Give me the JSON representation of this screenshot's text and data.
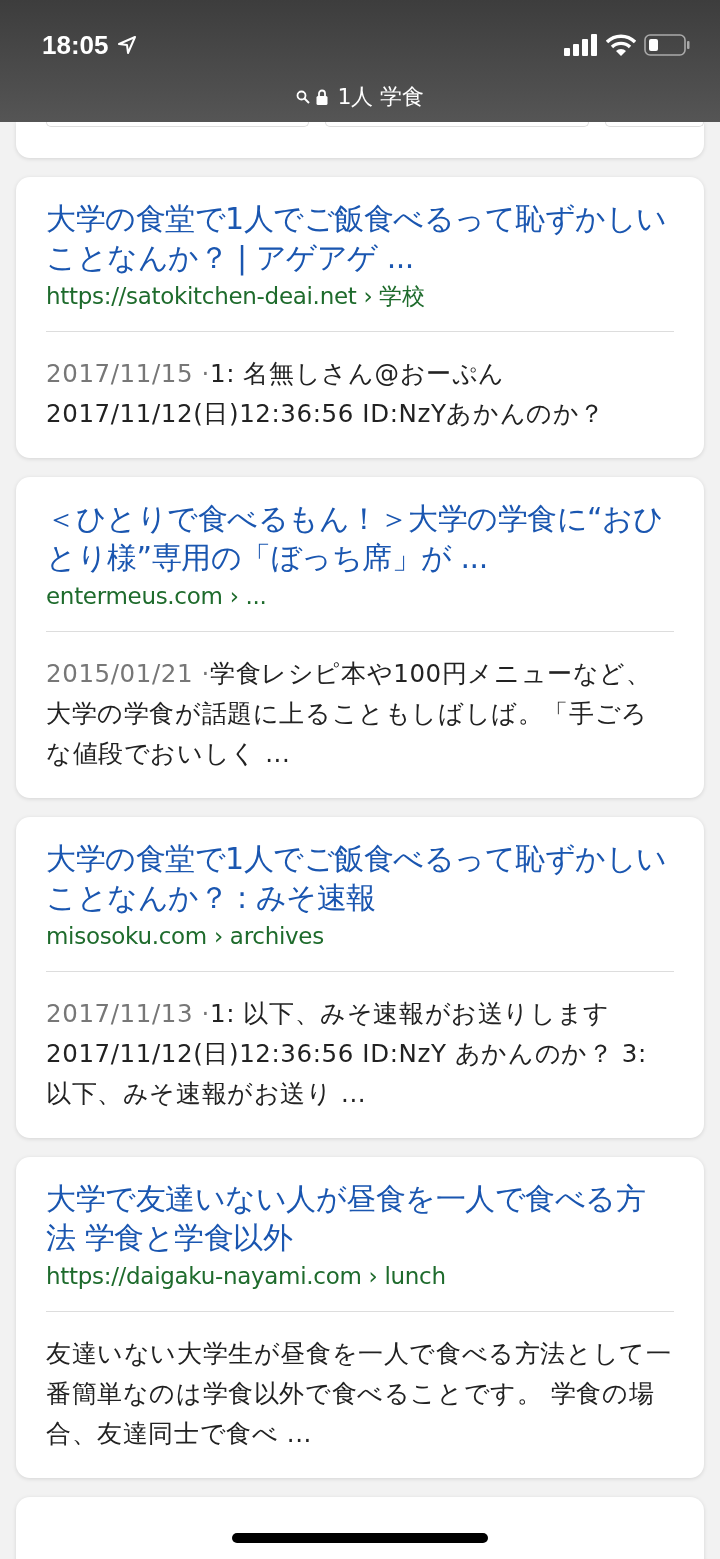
{
  "status_bar": {
    "time": "18:05"
  },
  "address_bar": {
    "query": "1人 学食"
  },
  "results": [
    {
      "title": "大学の食堂で1人でご飯食べるって恥ずかしいことなんか？ | アゲアゲ ...",
      "url": "https://satokitchen-deai.net",
      "path": "› 学校",
      "date": "2017/11/15 ·",
      "snippet": "1: 名無しさん@おーぷん 2017/11/12(日)12:36:56 ID:NzYあかんのか？"
    },
    {
      "title": "＜ひとりで食べるもん！＞大学の学食に“おひとり様”専用の「ぼっち席」が ...",
      "url": "entermeus.com",
      "path": "› ...",
      "date": "2015/01/21 ·",
      "snippet": "学食レシピ本や100円メニューなど、大学の学食が話題に上ることもしばしば。「手ごろな値段でおいしく ..."
    },
    {
      "title": "大学の食堂で1人でご飯食べるって恥ずかしいことなんか？ : みそ速報",
      "url": "misosoku.com",
      "path": "› archives",
      "date": "2017/11/13 ·",
      "snippet": "1: 以下、みそ速報がお送りします 2017/11/12(日)12:36:56 ID:NzY あかんのか？ 3: 以下、みそ速報がお送り ..."
    },
    {
      "title": "大学で友達いない人が昼食を一人で食べる方法 学食と学食以外",
      "url": "https://daigaku-nayami.com",
      "path": "› lunch",
      "snippet": "友達いない大学生が昼食を一人で食べる方法として一番簡単なのは学食以外で食べることです。 学食の場合、友達同士で食べ ..."
    }
  ]
}
